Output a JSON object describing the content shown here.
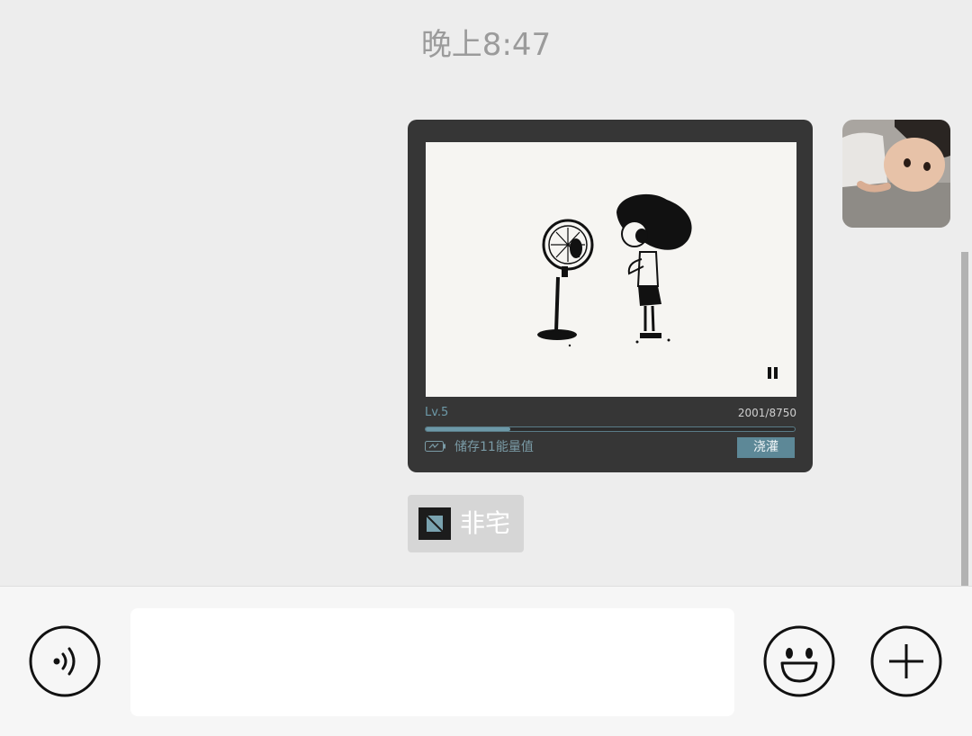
{
  "chat": {
    "timestamp": "晚上8:47"
  },
  "message": {
    "sender_avatar": "child-photo-avatar",
    "card": {
      "level": "Lv.5",
      "counter": "2001/8750",
      "progress_fraction": 0.229,
      "store_text": "储存11能量值",
      "water_button_label": "浇灌",
      "media_state_icon": "pause-icon",
      "accent_color": "#6d99a8"
    },
    "source": {
      "name": "非宅",
      "logo_icon": "app-logo-icon"
    }
  },
  "input_bar": {
    "voice_icon": "voice-icon",
    "message_value": "",
    "emoji_icon": "emoji-icon",
    "more_icon": "plus-icon"
  }
}
